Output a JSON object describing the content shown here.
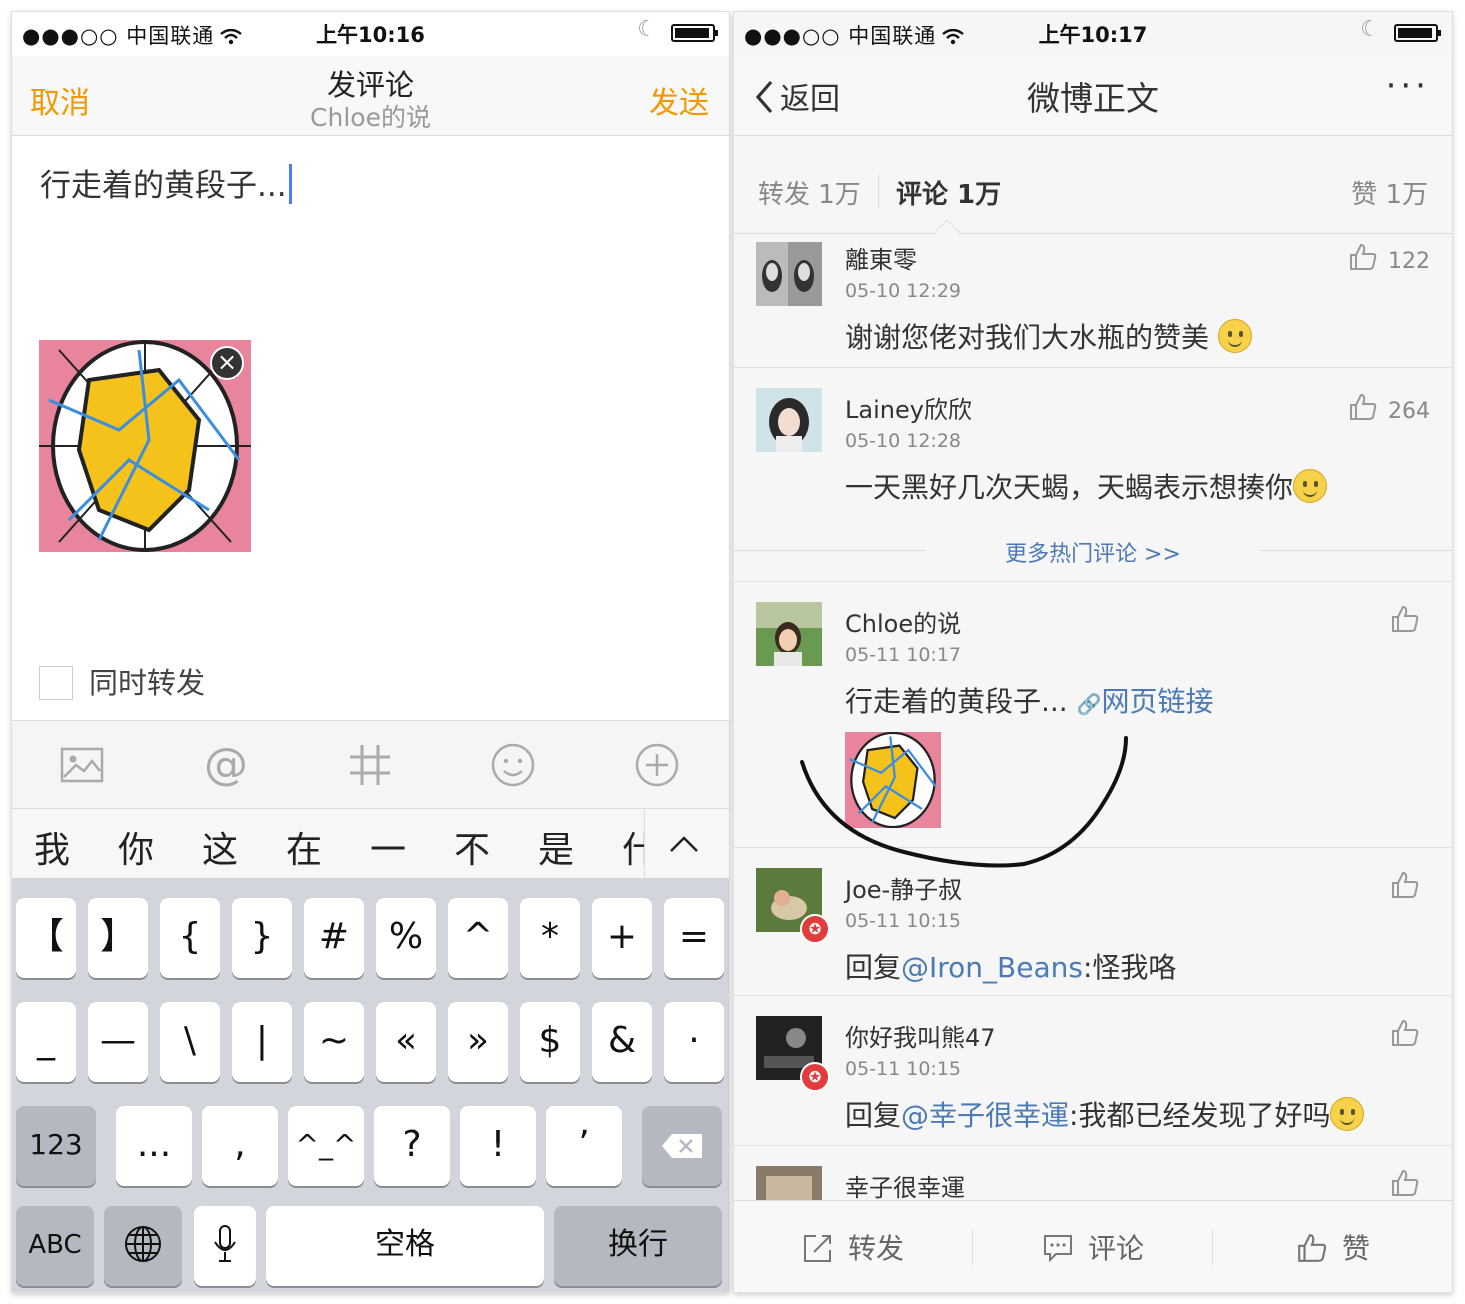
{
  "left": {
    "status": {
      "signal": "●●●○○ 中国联通",
      "time": "上午10:16"
    },
    "nav": {
      "cancel": "取消",
      "title": "发评论",
      "subtitle": "Chloe的说",
      "send": "发送"
    },
    "compose_text": "行走着的黄段子...",
    "repost_label": "同时转发",
    "toolbar_icons": [
      "image-icon",
      "at-icon",
      "hashtag-icon",
      "emoji-icon",
      "plus-icon"
    ],
    "candidates": [
      "我",
      "你",
      "这",
      "在",
      "一",
      "不",
      "是",
      "什"
    ],
    "keyboard": {
      "row1": [
        "【",
        "】",
        "{",
        "}",
        "#",
        "%",
        "^",
        "*",
        "+",
        "="
      ],
      "row2": [
        "_",
        "—",
        "\\",
        "|",
        "~",
        "«",
        "»",
        "$",
        "&",
        "·"
      ],
      "row3_left": "123",
      "row3": [
        "...",
        ",",
        "^_^",
        "?",
        "!",
        "’"
      ],
      "abc": "ABC",
      "space": "空格",
      "return": "换行"
    }
  },
  "right": {
    "status": {
      "signal": "●●●○○ 中国联通",
      "time": "上午10:17"
    },
    "nav": {
      "back": "返回",
      "title": "微博正文",
      "more": "···"
    },
    "tabs": {
      "repost": "转发 1万",
      "comment": "评论 1万",
      "like": "赞 1万"
    },
    "hot_comments": [
      {
        "name": "離東零",
        "time": "05-10 12:29",
        "text": "谢谢您佬对我们大水瓶的赞美",
        "likes": "122"
      },
      {
        "name": "Lainey欣欣",
        "time": "05-10 12:28",
        "text": "一天黑好几次天蝎，天蝎表示想揍你",
        "likes": "264"
      }
    ],
    "more_hot": "更多热门评论 >>",
    "my_comment": {
      "name": "Chloe的说",
      "time": "05-11 10:17",
      "text": "行走着的黄段子... ",
      "link": "网页链接"
    },
    "comments": [
      {
        "name": "Joe-静子叔",
        "time": "05-11 10:15",
        "prefix": "回复",
        "mention": "@Iron_Beans",
        "text": ":怪我咯"
      },
      {
        "name": "你好我叫熊47",
        "time": "05-11 10:15",
        "prefix": "回复",
        "mention": "@幸子很幸運",
        "text": ":我都已经发现了好吗"
      },
      {
        "name": "幸子很幸運"
      }
    ],
    "bottom": {
      "repost": "转发",
      "comment": "评论",
      "like": "赞"
    }
  }
}
